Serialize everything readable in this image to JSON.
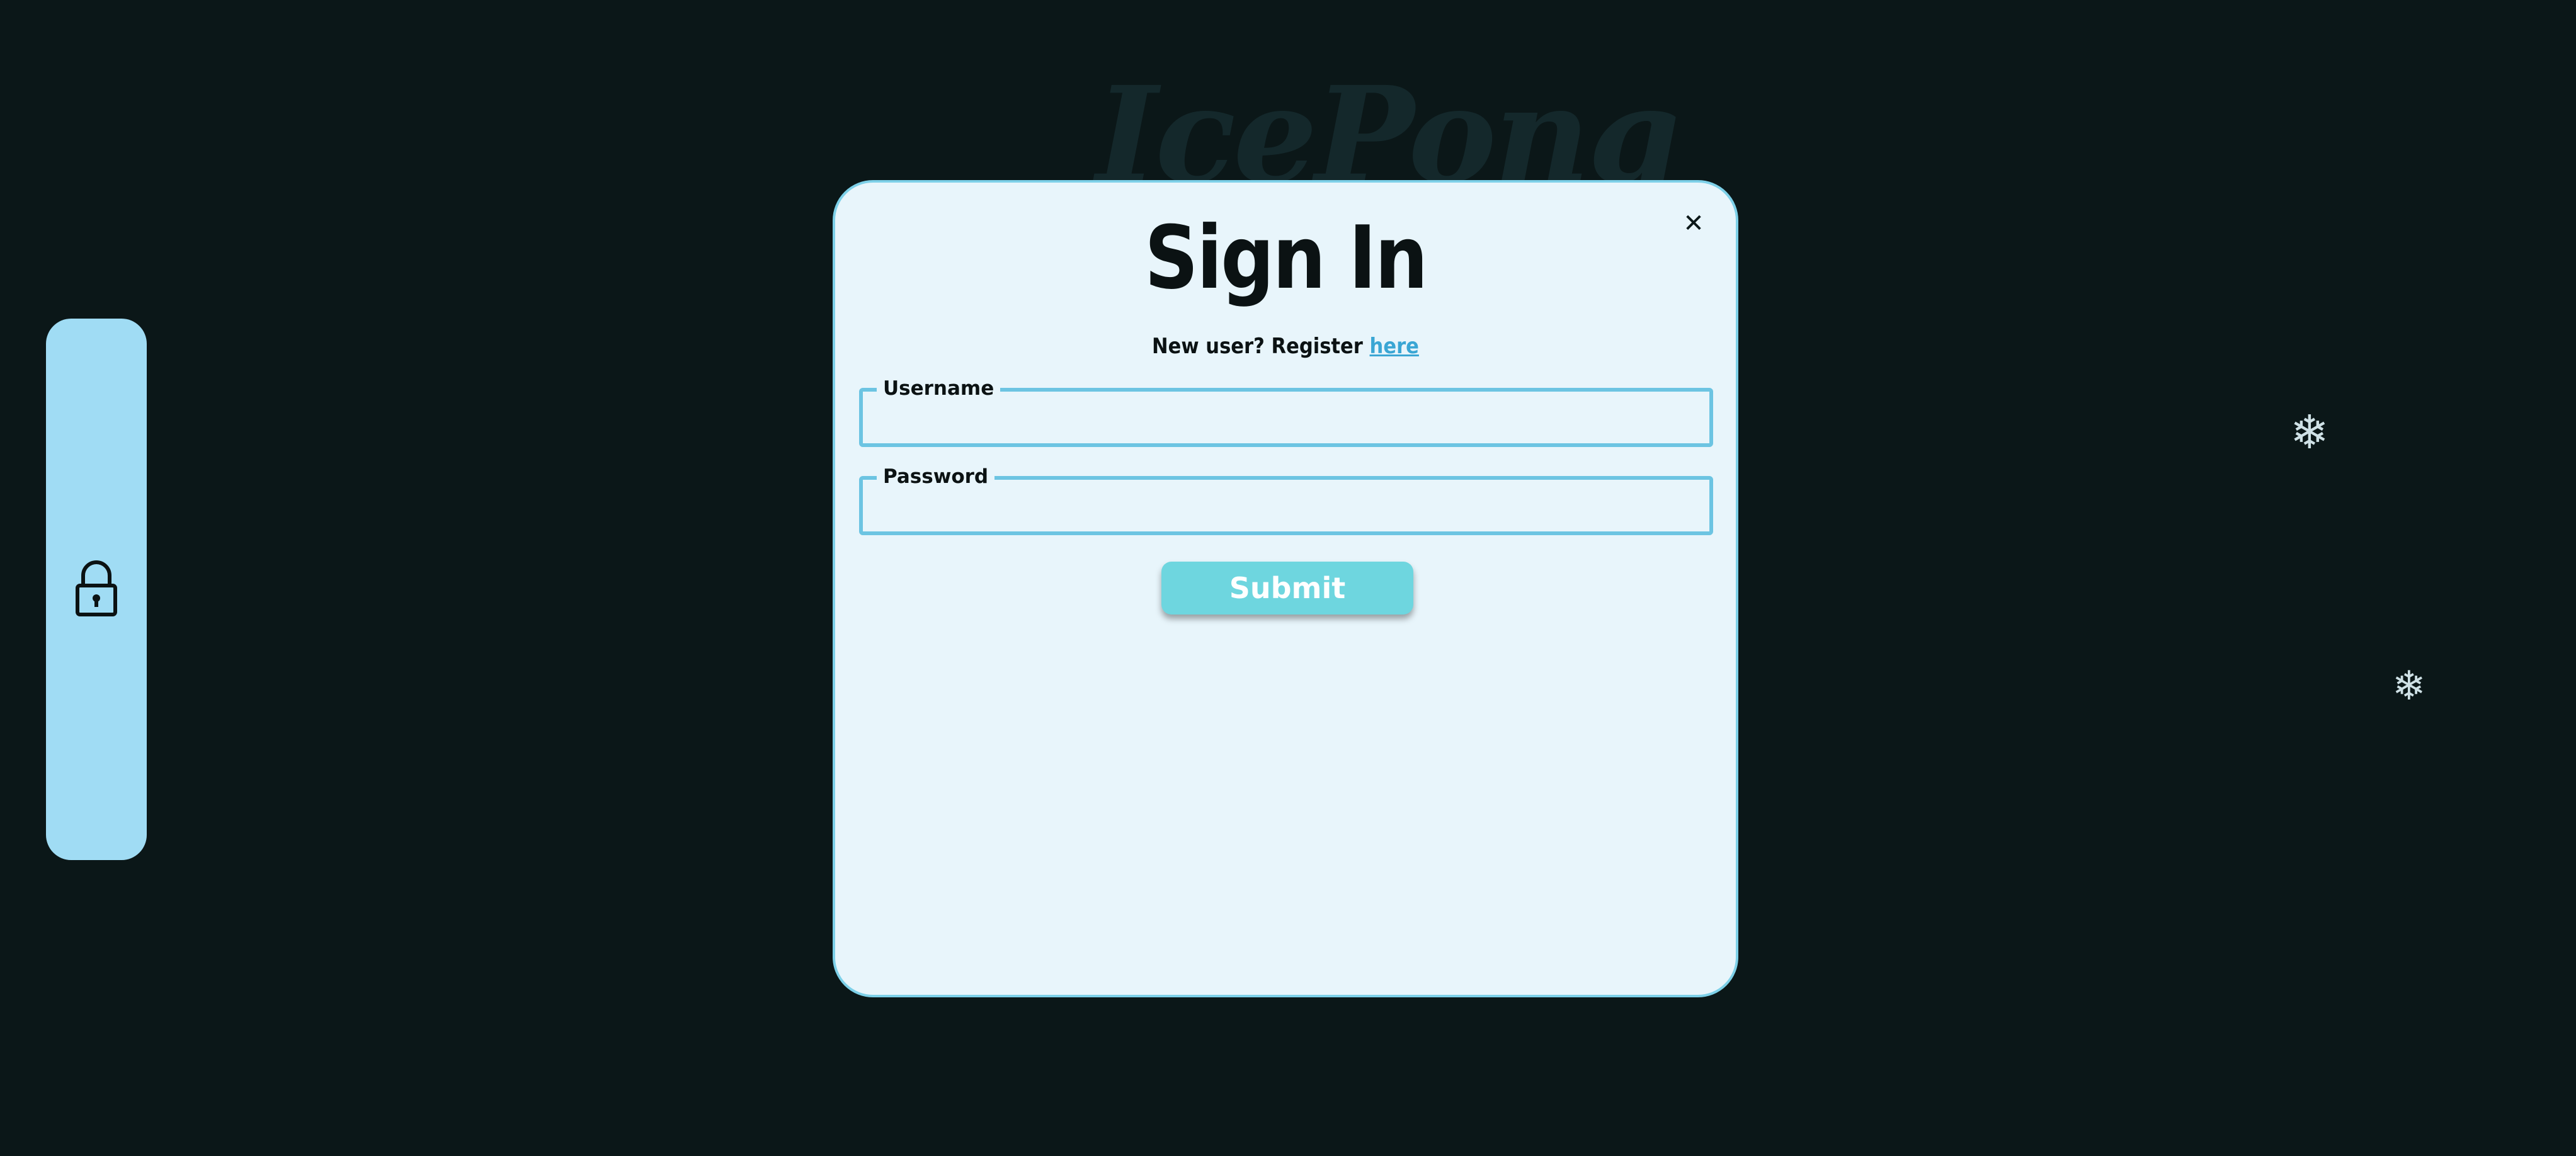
{
  "app": {
    "logo_text": "IcePong"
  },
  "sidebar": {
    "icon": "lock-icon"
  },
  "decorations": {
    "snowflake_glyph": "❄"
  },
  "modal": {
    "title": "Sign In",
    "close_label": "✕",
    "register_prompt": "New user? Register",
    "register_link": "here",
    "username_label": "Username",
    "username_value": "",
    "password_label": "Password",
    "password_value": "",
    "submit_label": "Submit"
  },
  "colors": {
    "background": "#0b1718",
    "sidebar": "#a0dcf4",
    "modal_background": "#e8f5fb",
    "field_border": "#6cc4e2",
    "submit_button": "#6ed6df",
    "link": "#3aa6d4"
  }
}
